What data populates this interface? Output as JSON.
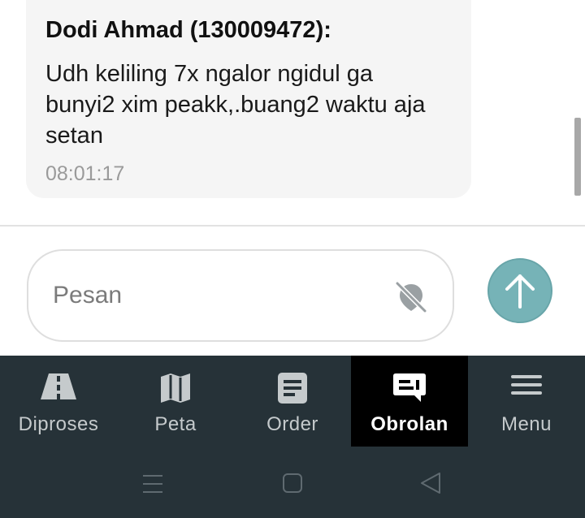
{
  "message": {
    "sender": "Dodi Ahmad (130009472):",
    "text": "Udh keliling 7x ngalor ngidul ga bunyi2 xim peakk,.buang2 waktu aja setan",
    "time": "08:01:17"
  },
  "composer": {
    "placeholder": "Pesan",
    "privacy_icon": "location-off-icon",
    "send_icon": "arrow-up-icon"
  },
  "navbar": {
    "items": [
      {
        "label": "Diproses",
        "icon": "road-icon"
      },
      {
        "label": "Peta",
        "icon": "map-icon"
      },
      {
        "label": "Order",
        "icon": "document-icon"
      },
      {
        "label": "Obrolan",
        "icon": "chat-icon",
        "active": true
      },
      {
        "label": "Menu",
        "icon": "menu-icon"
      }
    ]
  },
  "system_nav": {
    "buttons": [
      "recents-icon",
      "home-icon",
      "back-icon"
    ]
  },
  "colors": {
    "navbar_bg": "#263238",
    "active_bg": "#000000",
    "send_button": "#76b3b7",
    "bubble_bg": "#f5f5f5"
  }
}
